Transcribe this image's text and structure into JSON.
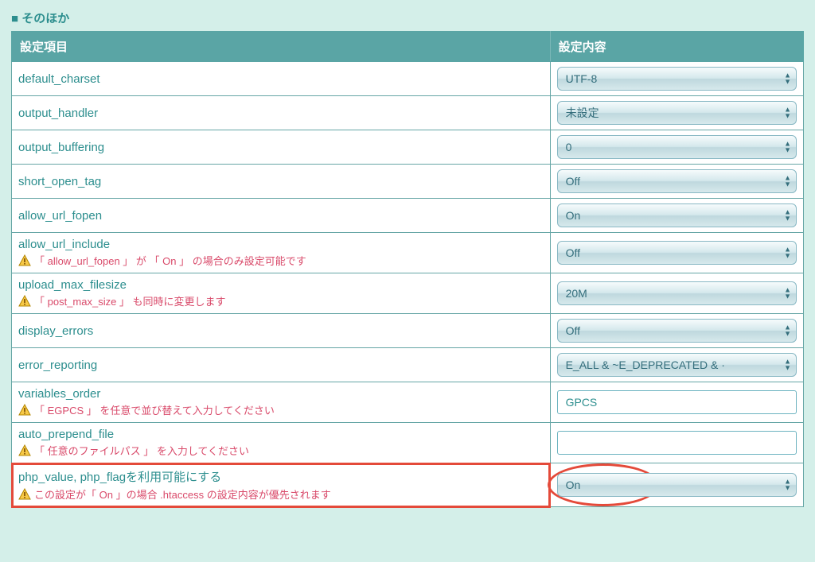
{
  "section": {
    "title": "そのほか"
  },
  "headers": {
    "name": "設定項目",
    "value": "設定内容"
  },
  "rows": [
    {
      "name": "default_charset",
      "type": "select",
      "value": "UTF-8"
    },
    {
      "name": "output_handler",
      "type": "select",
      "value": "未設定"
    },
    {
      "name": "output_buffering",
      "type": "select",
      "value": "0"
    },
    {
      "name": "short_open_tag",
      "type": "select",
      "value": "Off"
    },
    {
      "name": "allow_url_fopen",
      "type": "select",
      "value": "On"
    },
    {
      "name": "allow_url_include",
      "type": "select",
      "value": "Off",
      "hint": "「 allow_url_fopen 」 が 「 On 」 の場合のみ設定可能です"
    },
    {
      "name": "upload_max_filesize",
      "type": "select",
      "value": "20M",
      "hint": "「 post_max_size 」 も同時に変更します"
    },
    {
      "name": "display_errors",
      "type": "select",
      "value": "Off"
    },
    {
      "name": "error_reporting",
      "type": "select",
      "value": "E_ALL & ~E_DEPRECATED & ·"
    },
    {
      "name": "variables_order",
      "type": "input",
      "value": "GPCS",
      "hint": "「 EGPCS 」 を任意で並び替えて入力してください"
    },
    {
      "name": "auto_prepend_file",
      "type": "input",
      "value": "",
      "hint": "「 任意のファイルパス 」 を入力してください"
    },
    {
      "name": "php_value, php_flagを利用可能にする",
      "type": "select",
      "value": "On",
      "hint": "この設定が「 On 」の場合 .htaccess の設定内容が優先されます",
      "highlighted": true
    }
  ]
}
